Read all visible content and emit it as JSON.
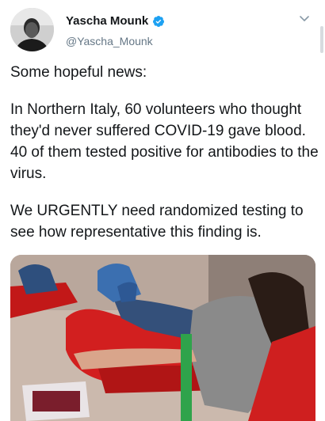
{
  "author": {
    "display_name": "Yascha Mounk",
    "handle": "@Yascha_Mounk",
    "verified": true
  },
  "tweet": {
    "paragraphs": [
      "Some hopeful news:",
      "In Northern Italy, 60 volunteers who thought they'd never suffered COVID-19 gave blood. 40 of them tested positive for antibodies to the virus.",
      "We URGENTLY need randomized testing to see how representative this finding is."
    ]
  },
  "icons": {
    "verified": "verified-badge-icon",
    "menu": "chevron-down-icon"
  },
  "colors": {
    "text": "#14171a",
    "secondary": "#657786",
    "verified": "#1da1f2"
  }
}
